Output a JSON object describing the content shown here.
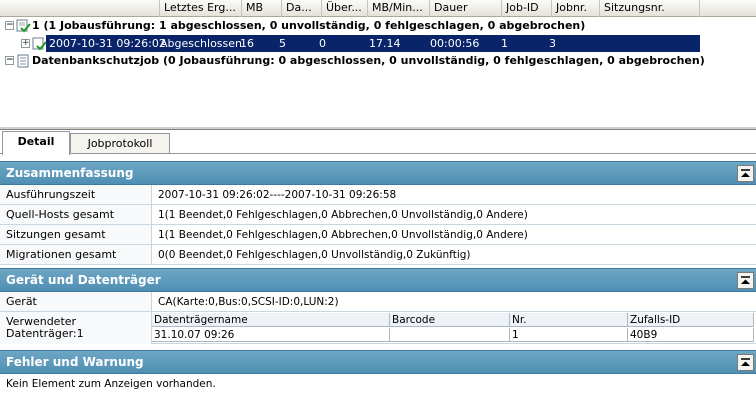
{
  "job_grid": {
    "columns": [
      "Letztes Erg...",
      "MB",
      "Da...",
      "Über...",
      "MB/Min...",
      "Dauer",
      "Job-ID",
      "Jobnr.",
      "Sitzungsnr."
    ],
    "rows": [
      {
        "text": "1 (1 Jobausführung: 1 abgeschlossen, 0 unvollständig, 0 fehlgeschlagen, 0 abgebrochen)"
      },
      {
        "cells": [
          "2007-10-31 09:26:02",
          "Abgeschlossen",
          "16",
          "5",
          "0",
          "17.14",
          "00:00:56",
          "1",
          "3"
        ]
      },
      {
        "text": "Datenbankschutzjob (0 Jobausführung: 0 abgeschlossen, 0 unvollständig, 0 fehlgeschlagen, 0 abgebrochen)"
      }
    ]
  },
  "tabs": {
    "detail": "Detail",
    "jobprotokoll": "Jobprotokoll"
  },
  "summary": {
    "title": "Zusammenfassung",
    "rows": [
      {
        "label": "Ausführungszeit",
        "value": "2007-10-31 09:26:02----2007-10-31 09:26:58"
      },
      {
        "label": "Quell-Hosts gesamt",
        "value": "1(1 Beendet,0 Fehlgeschlagen,0 Abbrechen,0 Unvollständig,0 Andere)"
      },
      {
        "label": "Sitzungen gesamt",
        "value": "1(1 Beendet,0 Fehlgeschlagen,0 Abbrechen,0 Unvollständig,0 Andere)"
      },
      {
        "label": "Migrationen gesamt",
        "value": "0(0 Beendet,0 Fehlgeschlagen,0 Unvollständig,0 Zukünftig)"
      }
    ]
  },
  "device": {
    "title": "Gerät und Datenträger",
    "device_label": "Gerät",
    "device_value": "CA(Karte:0,Bus:0,SCSI-ID:0,LUN:2)",
    "medium_label_1": "Verwendeter",
    "medium_label_2": "Datenträger:1",
    "medium_headers": [
      "Datenträgername",
      "Barcode",
      "Nr.",
      "Zufalls-ID"
    ],
    "medium_values": [
      "31.10.07 09:26",
      "",
      "1",
      "40B9"
    ]
  },
  "errors": {
    "title": "Fehler und Warnung",
    "message": "Kein Element zum Anzeigen vorhanden."
  },
  "colors": {
    "selection": "#0a246a",
    "section_header": "#5b97b9"
  }
}
